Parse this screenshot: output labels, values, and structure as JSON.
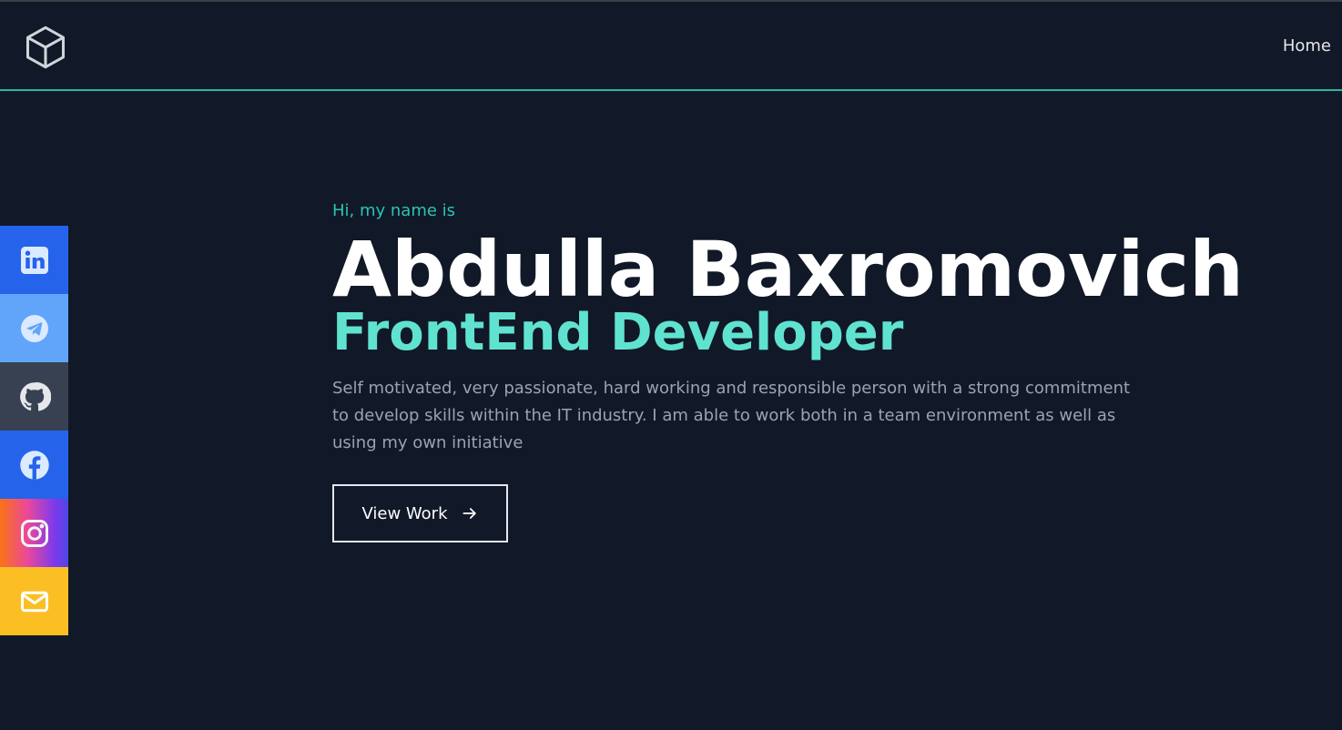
{
  "nav": {
    "logo_icon": "cube-icon",
    "links": [
      {
        "label": "Home"
      }
    ]
  },
  "social": [
    {
      "name": "linkedin",
      "icon": "linkedin-icon",
      "color": "#2563eb"
    },
    {
      "name": "telegram",
      "icon": "telegram-icon",
      "color": "#60a5fa"
    },
    {
      "name": "github",
      "icon": "github-icon",
      "color": "#374151"
    },
    {
      "name": "facebook",
      "icon": "facebook-icon",
      "color": "#2563eb"
    },
    {
      "name": "instagram",
      "icon": "instagram-icon",
      "color": "#ec4899"
    },
    {
      "name": "email",
      "icon": "mail-icon",
      "color": "#fbbf24"
    }
  ],
  "hero": {
    "greeting": "Hi, my name is",
    "name": "Abdulla Baxromovich",
    "role": "FrontEnd Developer",
    "bio": "Self motivated, very passionate, hard working and responsible person with a strong commitment to develop skills within the IT industry. I am able to work both in a team environment as well as using my own initiative",
    "button_label": "View Work"
  },
  "colors": {
    "background": "#111827",
    "accent": "#2bc4b6",
    "role": "#5fe3d0"
  }
}
